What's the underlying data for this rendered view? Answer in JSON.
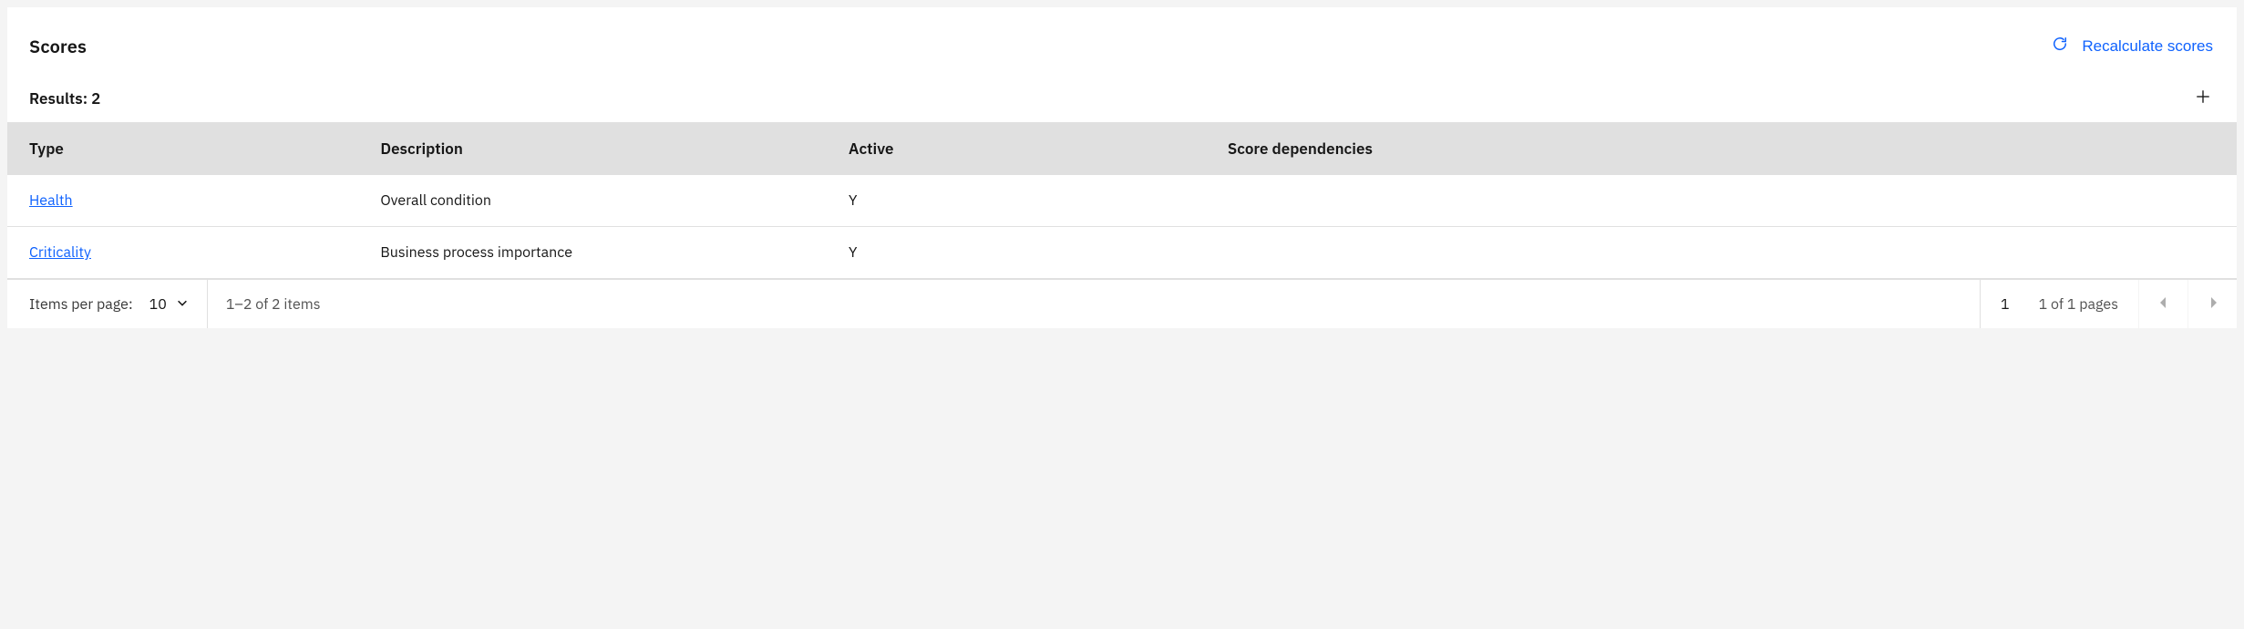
{
  "panel": {
    "title": "Scores",
    "recalculate_label": "Recalculate scores"
  },
  "results": {
    "label": "Results: 2"
  },
  "table": {
    "headers": {
      "type": "Type",
      "description": "Description",
      "active": "Active",
      "dependencies": "Score dependencies"
    },
    "rows": [
      {
        "type": "Health",
        "description": "Overall condition",
        "active": "Y",
        "dependencies": ""
      },
      {
        "type": "Criticality",
        "description": "Business process importance",
        "active": "Y",
        "dependencies": ""
      }
    ]
  },
  "pagination": {
    "items_per_page_label": "Items per page:",
    "items_per_page_value": "10",
    "range_text": "1–2 of 2 items",
    "page_select_value": "1",
    "pages_text": "1 of 1 pages"
  }
}
